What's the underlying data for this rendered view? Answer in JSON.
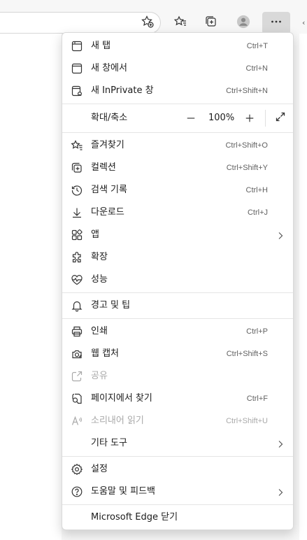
{
  "menu": {
    "new_tab": {
      "label": "새 탭",
      "shortcut": "Ctrl+T",
      "icon": "new-tab-icon"
    },
    "new_window": {
      "label": "새 창에서",
      "shortcut": "Ctrl+N",
      "icon": "new-window-icon"
    },
    "inprivate": {
      "label": "새 InPrivate 창",
      "shortcut": "Ctrl+Shift+N",
      "icon": "inprivate-icon"
    },
    "zoom": {
      "label": "확대/축소",
      "value": "100%",
      "minus": "—",
      "plus": "+",
      "icon": "fullscreen-icon"
    },
    "favorites": {
      "label": "즐겨찾기",
      "shortcut": "Ctrl+Shift+O",
      "icon": "favorites-icon"
    },
    "collections": {
      "label": "컬렉션",
      "shortcut": "Ctrl+Shift+Y",
      "icon": "collections-icon"
    },
    "history": {
      "label": "검색 기록",
      "shortcut": "Ctrl+H",
      "icon": "history-icon"
    },
    "downloads": {
      "label": "다운로드",
      "shortcut": "Ctrl+J",
      "icon": "download-icon"
    },
    "apps": {
      "label": "앱",
      "icon": "apps-icon"
    },
    "extensions": {
      "label": "확장",
      "icon": "extensions-icon"
    },
    "performance": {
      "label": "성능",
      "icon": "performance-icon"
    },
    "alerts": {
      "label": "경고 및 팁",
      "icon": "bell-icon"
    },
    "print": {
      "label": "인쇄",
      "shortcut": "Ctrl+P",
      "icon": "printer-icon"
    },
    "capture": {
      "label": "웹 캡처",
      "shortcut": "Ctrl+Shift+S",
      "icon": "web-capture-icon"
    },
    "share": {
      "label": "공유",
      "icon": "share-icon"
    },
    "find": {
      "label": "페이지에서 찾기",
      "shortcut": "Ctrl+F",
      "icon": "find-icon"
    },
    "read_aloud": {
      "label": "소리내어 읽기",
      "shortcut": "Ctrl+Shift+U",
      "icon": "read-aloud-icon"
    },
    "more_tools": {
      "label": "기타 도구"
    },
    "settings": {
      "label": "설정",
      "icon": "gear-icon"
    },
    "help": {
      "label": "도움말 및 피드백",
      "icon": "help-icon"
    },
    "close": {
      "label": "Microsoft Edge 닫기"
    }
  },
  "toolbar": {
    "icons": [
      "favorite-add-icon",
      "favorites-icon",
      "collections-icon",
      "profile-icon",
      "more-icon"
    ]
  },
  "colors": {
    "accent": "#d9d9d9",
    "disabled": "#a9a9a9",
    "shortcut": "#616161"
  }
}
